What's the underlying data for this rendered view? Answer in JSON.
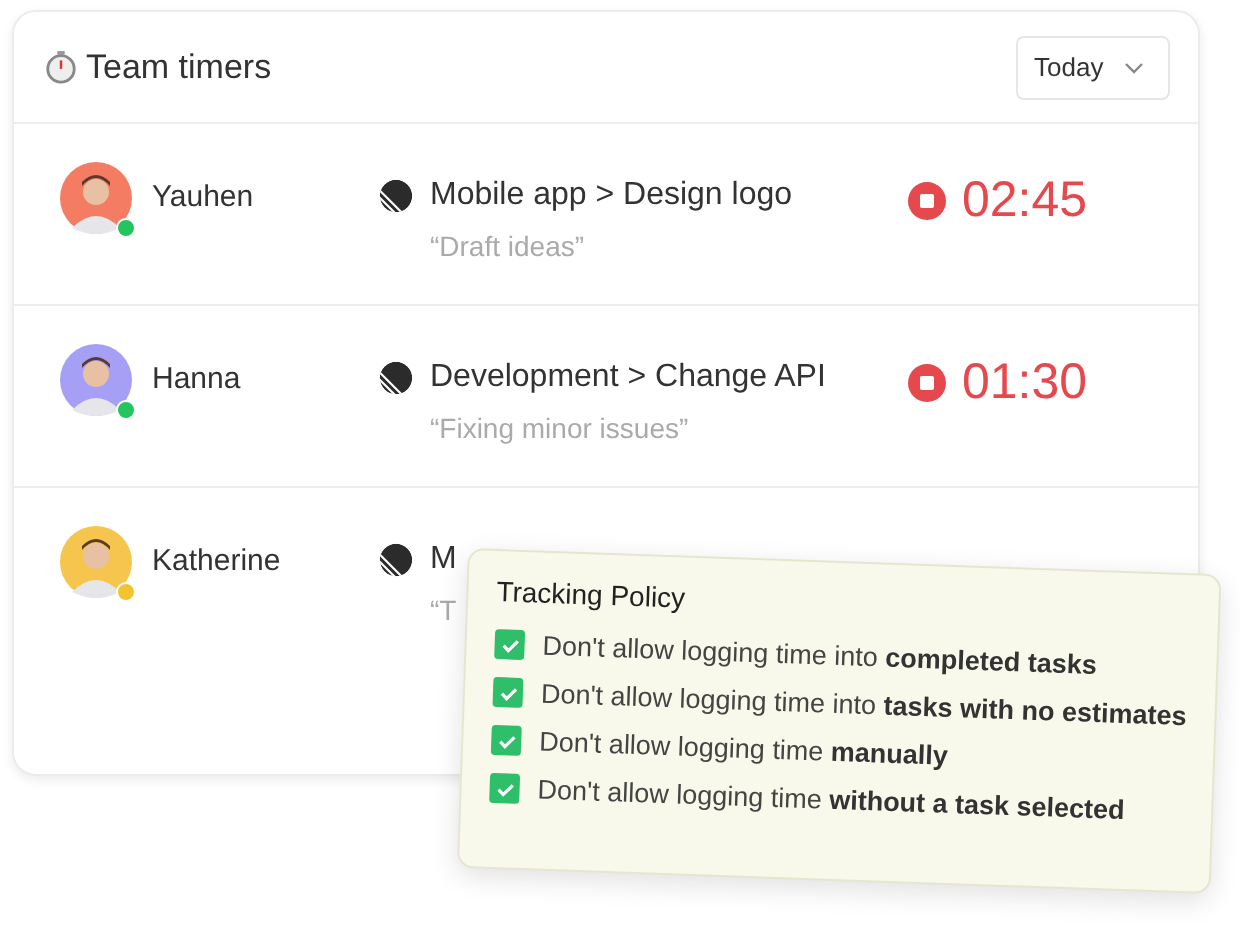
{
  "header": {
    "title": "Team timers",
    "range_select": {
      "value": "Today"
    }
  },
  "members": [
    {
      "name": "Yauhen",
      "color": "#22c55e",
      "project": "Mobile app > Design logo",
      "note": "“Draft ideas”",
      "timer": "02:45"
    },
    {
      "name": "Hanna",
      "color": "#22c55e",
      "project": "Development > Change API",
      "note": "“Fixing minor issues”",
      "timer": "01:30"
    },
    {
      "name": "Katherine",
      "color": "#f4c430",
      "project": "M",
      "note": "“T"
    }
  ],
  "policy": {
    "title": "Tracking Policy",
    "items": [
      {
        "text": "Don't allow logging time into **completed tasks**",
        "checked": true
      },
      {
        "text": "Don't allow logging time into **tasks with no estimates**",
        "checked": true
      },
      {
        "text": "Don't allow logging time **manually**",
        "checked": true
      },
      {
        "text": "Don't allow logging time **without a task selected**",
        "checked": true
      }
    ]
  }
}
